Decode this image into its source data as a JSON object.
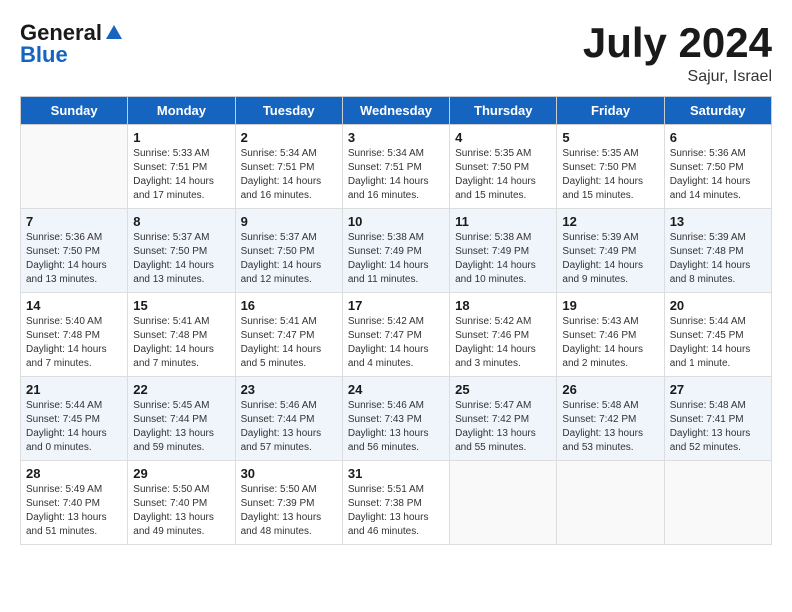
{
  "header": {
    "logo_general": "General",
    "logo_blue": "Blue",
    "title": "July 2024",
    "location": "Sajur, Israel"
  },
  "days_of_week": [
    "Sunday",
    "Monday",
    "Tuesday",
    "Wednesday",
    "Thursday",
    "Friday",
    "Saturday"
  ],
  "weeks": [
    [
      {
        "day": "",
        "sunrise": "",
        "sunset": "",
        "daylight": ""
      },
      {
        "day": "1",
        "sunrise": "Sunrise: 5:33 AM",
        "sunset": "Sunset: 7:51 PM",
        "daylight": "Daylight: 14 hours and 17 minutes."
      },
      {
        "day": "2",
        "sunrise": "Sunrise: 5:34 AM",
        "sunset": "Sunset: 7:51 PM",
        "daylight": "Daylight: 14 hours and 16 minutes."
      },
      {
        "day": "3",
        "sunrise": "Sunrise: 5:34 AM",
        "sunset": "Sunset: 7:51 PM",
        "daylight": "Daylight: 14 hours and 16 minutes."
      },
      {
        "day": "4",
        "sunrise": "Sunrise: 5:35 AM",
        "sunset": "Sunset: 7:50 PM",
        "daylight": "Daylight: 14 hours and 15 minutes."
      },
      {
        "day": "5",
        "sunrise": "Sunrise: 5:35 AM",
        "sunset": "Sunset: 7:50 PM",
        "daylight": "Daylight: 14 hours and 15 minutes."
      },
      {
        "day": "6",
        "sunrise": "Sunrise: 5:36 AM",
        "sunset": "Sunset: 7:50 PM",
        "daylight": "Daylight: 14 hours and 14 minutes."
      }
    ],
    [
      {
        "day": "7",
        "sunrise": "Sunrise: 5:36 AM",
        "sunset": "Sunset: 7:50 PM",
        "daylight": "Daylight: 14 hours and 13 minutes."
      },
      {
        "day": "8",
        "sunrise": "Sunrise: 5:37 AM",
        "sunset": "Sunset: 7:50 PM",
        "daylight": "Daylight: 14 hours and 13 minutes."
      },
      {
        "day": "9",
        "sunrise": "Sunrise: 5:37 AM",
        "sunset": "Sunset: 7:50 PM",
        "daylight": "Daylight: 14 hours and 12 minutes."
      },
      {
        "day": "10",
        "sunrise": "Sunrise: 5:38 AM",
        "sunset": "Sunset: 7:49 PM",
        "daylight": "Daylight: 14 hours and 11 minutes."
      },
      {
        "day": "11",
        "sunrise": "Sunrise: 5:38 AM",
        "sunset": "Sunset: 7:49 PM",
        "daylight": "Daylight: 14 hours and 10 minutes."
      },
      {
        "day": "12",
        "sunrise": "Sunrise: 5:39 AM",
        "sunset": "Sunset: 7:49 PM",
        "daylight": "Daylight: 14 hours and 9 minutes."
      },
      {
        "day": "13",
        "sunrise": "Sunrise: 5:39 AM",
        "sunset": "Sunset: 7:48 PM",
        "daylight": "Daylight: 14 hours and 8 minutes."
      }
    ],
    [
      {
        "day": "14",
        "sunrise": "Sunrise: 5:40 AM",
        "sunset": "Sunset: 7:48 PM",
        "daylight": "Daylight: 14 hours and 7 minutes."
      },
      {
        "day": "15",
        "sunrise": "Sunrise: 5:41 AM",
        "sunset": "Sunset: 7:48 PM",
        "daylight": "Daylight: 14 hours and 7 minutes."
      },
      {
        "day": "16",
        "sunrise": "Sunrise: 5:41 AM",
        "sunset": "Sunset: 7:47 PM",
        "daylight": "Daylight: 14 hours and 5 minutes."
      },
      {
        "day": "17",
        "sunrise": "Sunrise: 5:42 AM",
        "sunset": "Sunset: 7:47 PM",
        "daylight": "Daylight: 14 hours and 4 minutes."
      },
      {
        "day": "18",
        "sunrise": "Sunrise: 5:42 AM",
        "sunset": "Sunset: 7:46 PM",
        "daylight": "Daylight: 14 hours and 3 minutes."
      },
      {
        "day": "19",
        "sunrise": "Sunrise: 5:43 AM",
        "sunset": "Sunset: 7:46 PM",
        "daylight": "Daylight: 14 hours and 2 minutes."
      },
      {
        "day": "20",
        "sunrise": "Sunrise: 5:44 AM",
        "sunset": "Sunset: 7:45 PM",
        "daylight": "Daylight: 14 hours and 1 minute."
      }
    ],
    [
      {
        "day": "21",
        "sunrise": "Sunrise: 5:44 AM",
        "sunset": "Sunset: 7:45 PM",
        "daylight": "Daylight: 14 hours and 0 minutes."
      },
      {
        "day": "22",
        "sunrise": "Sunrise: 5:45 AM",
        "sunset": "Sunset: 7:44 PM",
        "daylight": "Daylight: 13 hours and 59 minutes."
      },
      {
        "day": "23",
        "sunrise": "Sunrise: 5:46 AM",
        "sunset": "Sunset: 7:44 PM",
        "daylight": "Daylight: 13 hours and 57 minutes."
      },
      {
        "day": "24",
        "sunrise": "Sunrise: 5:46 AM",
        "sunset": "Sunset: 7:43 PM",
        "daylight": "Daylight: 13 hours and 56 minutes."
      },
      {
        "day": "25",
        "sunrise": "Sunrise: 5:47 AM",
        "sunset": "Sunset: 7:42 PM",
        "daylight": "Daylight: 13 hours and 55 minutes."
      },
      {
        "day": "26",
        "sunrise": "Sunrise: 5:48 AM",
        "sunset": "Sunset: 7:42 PM",
        "daylight": "Daylight: 13 hours and 53 minutes."
      },
      {
        "day": "27",
        "sunrise": "Sunrise: 5:48 AM",
        "sunset": "Sunset: 7:41 PM",
        "daylight": "Daylight: 13 hours and 52 minutes."
      }
    ],
    [
      {
        "day": "28",
        "sunrise": "Sunrise: 5:49 AM",
        "sunset": "Sunset: 7:40 PM",
        "daylight": "Daylight: 13 hours and 51 minutes."
      },
      {
        "day": "29",
        "sunrise": "Sunrise: 5:50 AM",
        "sunset": "Sunset: 7:40 PM",
        "daylight": "Daylight: 13 hours and 49 minutes."
      },
      {
        "day": "30",
        "sunrise": "Sunrise: 5:50 AM",
        "sunset": "Sunset: 7:39 PM",
        "daylight": "Daylight: 13 hours and 48 minutes."
      },
      {
        "day": "31",
        "sunrise": "Sunrise: 5:51 AM",
        "sunset": "Sunset: 7:38 PM",
        "daylight": "Daylight: 13 hours and 46 minutes."
      },
      {
        "day": "",
        "sunrise": "",
        "sunset": "",
        "daylight": ""
      },
      {
        "day": "",
        "sunrise": "",
        "sunset": "",
        "daylight": ""
      },
      {
        "day": "",
        "sunrise": "",
        "sunset": "",
        "daylight": ""
      }
    ]
  ]
}
